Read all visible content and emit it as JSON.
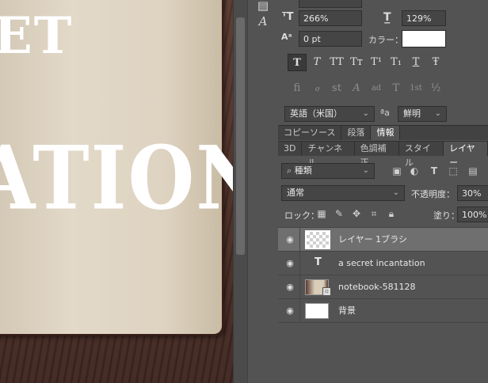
{
  "canvas": {
    "text_line_1": "ET",
    "text_line_2": "ATION"
  },
  "character": {
    "font_size_value": "266%",
    "leading_value": "129%",
    "tracking_value": "0 pt",
    "color_label": "カラー：",
    "color_swatch": "#ffffff",
    "typo_buttons": [
      "T",
      "T",
      "TT",
      "Tт",
      "T¹",
      "T₁",
      "T",
      "Ŧ"
    ],
    "opentype_buttons": [
      "fi",
      "ℴ",
      "st",
      "A",
      "ad",
      "T",
      "1st",
      "½"
    ],
    "language_select": "英語（米国）",
    "aa_label": "ªa",
    "antialias_select": "鮮明"
  },
  "panel_tabs_top": [
    "コピーソース",
    "段落",
    "情報"
  ],
  "panel_tabs_main": [
    "3D",
    "チャンネル",
    "色調補正",
    "スタイル",
    "レイヤー"
  ],
  "layers_panel": {
    "filter_select": "種類",
    "blend_mode": "通常",
    "opacity_label": "不透明度：",
    "opacity_value": "30%",
    "lock_label": "ロック：",
    "fill_label": "塗り：",
    "fill_value": "100%",
    "layers": [
      {
        "name": "レイヤー 1ブラシ",
        "type": "pixel",
        "selected": true
      },
      {
        "name": "a secret   incantation",
        "type": "text",
        "selected": false
      },
      {
        "name": "notebook-581128",
        "type": "smart",
        "selected": false
      },
      {
        "name": "背景",
        "type": "background",
        "selected": false
      }
    ]
  },
  "icons": {
    "tool_1": "paragraph-icon",
    "tool_2": "character-icon"
  }
}
